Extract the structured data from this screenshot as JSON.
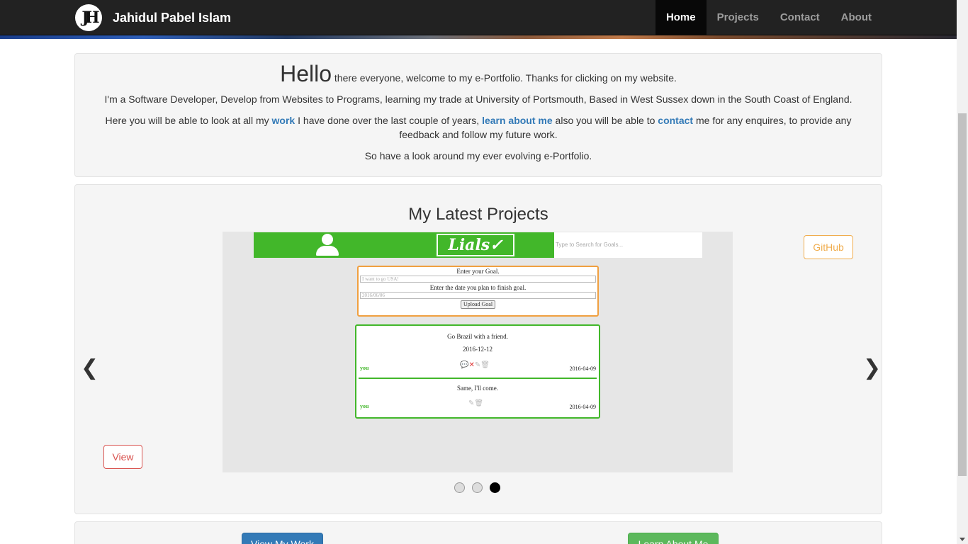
{
  "brand": {
    "logo_text": "JH",
    "name": "Jahidul Pabel Islam"
  },
  "nav": [
    {
      "label": "Home",
      "active": true
    },
    {
      "label": "Projects",
      "active": false
    },
    {
      "label": "Contact",
      "active": false
    },
    {
      "label": "About",
      "active": false
    }
  ],
  "intro": {
    "hello": "Hello",
    "hello_rest": " there everyone, welcome to my e-Portfolio. Thanks for clicking on my website.",
    "p2": "I'm a Software Developer, Develop from Websites to Programs, learning my trade at University of Portsmouth, Based in West Sussex down in the South Coast of England.",
    "p3_a": "Here you will be able to look at all my ",
    "p3_link_work": "work",
    "p3_b": " I have done over the last couple of years, ",
    "p3_link_learn": "learn about me",
    "p3_c": " also you will be able to ",
    "p3_link_contact": "contact",
    "p3_d": " me for any enquires, to provide any feedback and follow my future work.",
    "p4": "So have a look around my ever evolving e-Portfolio."
  },
  "projects": {
    "title": "My Latest Projects",
    "github_label": "GitHub",
    "view_label": "View",
    "prev_icon": "chevron-left-icon",
    "next_icon": "chevron-right-icon",
    "indicators": 3,
    "active_indicator": 2,
    "slide": {
      "app_logo": "Lials✓",
      "search_placeholder": "Type to Search for Goals...",
      "goal_label": "Enter your Goal.",
      "goal_placeholder": "I want to go USA!",
      "date_label": "Enter the date you plan to finish goal.",
      "date_placeholder": "2016/06/06",
      "upload_label": "Upload Goal",
      "post_text": "Go Brazil with a friend.",
      "post_date": "2016-12-12",
      "post_user": "you",
      "post_stamp": "2016-04-09",
      "reply_text": "Same, I'll come.",
      "reply_user": "you",
      "reply_stamp": "2016-04-09"
    }
  },
  "bottom": {
    "view_work_label": "View My Work",
    "learn_label": "Learn About Me"
  },
  "colors": {
    "navbar": "#222222",
    "link": "#337ab7",
    "github": "#f0ad4e",
    "view": "#d9534f",
    "app_green": "#42b72a"
  }
}
